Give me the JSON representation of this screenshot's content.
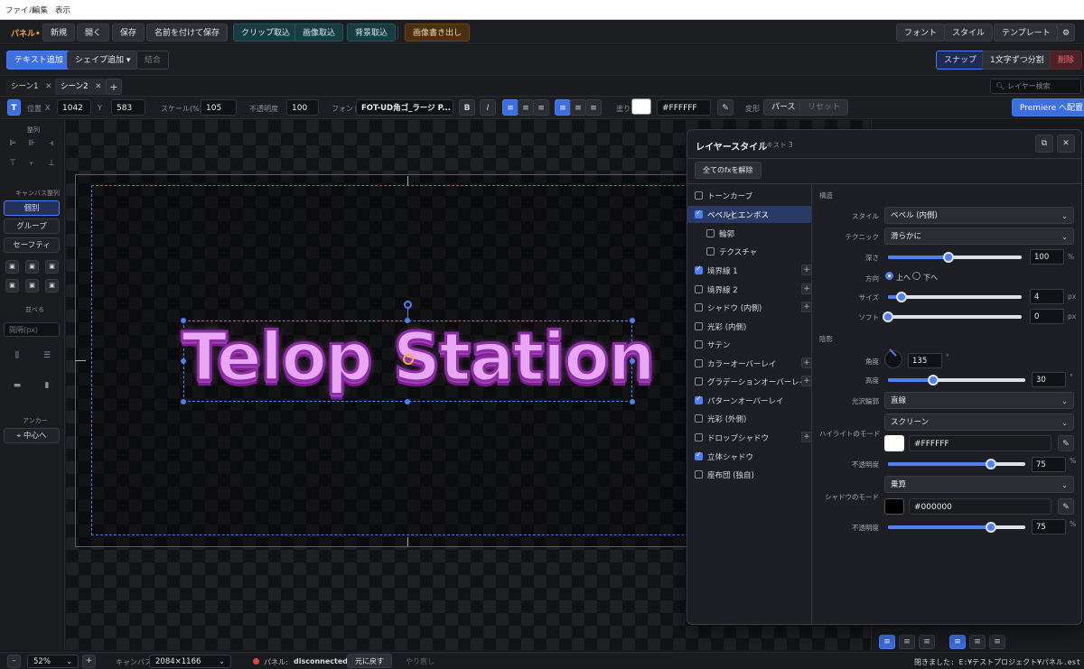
{
  "menubar": {
    "file": "ファイル",
    "edit": "編集",
    "view": "表示"
  },
  "toolbar1": {
    "app_label": "パネル",
    "app_marker": "•",
    "new": "新規",
    "open": "開く",
    "save": "保存",
    "save_as": "名前を付けて保存",
    "clip_import": "クリップ取込",
    "image_import": "画像取込",
    "bg_import": "背景取込",
    "image_export": "画像書き出し",
    "font": "フォント",
    "style": "スタイル",
    "template": "テンプレート",
    "settings_icon": "gear-icon"
  },
  "toolbar2": {
    "add_text": "テキスト追加",
    "add_shape": "シェイプ追加",
    "add_shape_chev": "▾",
    "combine": "結合",
    "snap": "スナップ",
    "split_chars": "1文字ずつ分割",
    "delete": "削除"
  },
  "tabs": {
    "items": [
      {
        "label": "シーン1"
      },
      {
        "label": "シーン2"
      }
    ],
    "add": "+",
    "search_placeholder": "レイヤー検索"
  },
  "props": {
    "type_badge": "T",
    "pos_label": "位置",
    "x_label": "X",
    "x": "1042",
    "y_label": "Y",
    "y": "583",
    "scale_label": "スケール(%)",
    "scale": "105",
    "opacity_label": "不透明度",
    "opacity": "100",
    "font_label": "フォント",
    "font": "FOT-UD角ゴ_ラージ P...",
    "bold": "B",
    "italic": "I",
    "fill_label": "塗り",
    "fill_color": "#FFFFFF",
    "fill_hex": "#FFFFFF",
    "transform_label": "変形",
    "perspective": "パース",
    "reset": "リセット",
    "premiere": "Premiere へ配置"
  },
  "sidebar": {
    "align_title": "整列",
    "canvas_align_title": "キャンバス整列",
    "individual": "個別",
    "group": "グループ",
    "safety": "セーフティ",
    "distribute_title": "並べる",
    "spacing_placeholder": "間隔(px)",
    "anchor_title": "アンカー",
    "center": "中心へ"
  },
  "canvas": {
    "text": "Telop Station"
  },
  "dialog": {
    "title": "レイヤースタイル",
    "subtitle": "— テキスト 3",
    "clear_all": "全てのfxを解除",
    "fx_items": [
      {
        "label": "トーンカーブ",
        "checked": false,
        "plus": false,
        "indent": false
      },
      {
        "label": "ベベルとエンボス",
        "checked": true,
        "plus": false,
        "indent": false,
        "active": true
      },
      {
        "label": "輪郭",
        "checked": false,
        "plus": false,
        "indent": true
      },
      {
        "label": "テクスチャ",
        "checked": false,
        "plus": false,
        "indent": true
      },
      {
        "label": "境界線 1",
        "checked": true,
        "plus": true,
        "indent": false
      },
      {
        "label": "境界線 2",
        "checked": false,
        "plus": true,
        "indent": false
      },
      {
        "label": "シャドウ (内側)",
        "checked": false,
        "plus": true,
        "indent": false
      },
      {
        "label": "光彩 (内側)",
        "checked": false,
        "plus": false,
        "indent": false
      },
      {
        "label": "サテン",
        "checked": false,
        "plus": false,
        "indent": false
      },
      {
        "label": "カラーオーバーレイ",
        "checked": false,
        "plus": true,
        "indent": false
      },
      {
        "label": "グラデーションオーバーレイ",
        "checked": false,
        "plus": true,
        "indent": false
      },
      {
        "label": "パターンオーバーレイ",
        "checked": true,
        "plus": false,
        "indent": false
      },
      {
        "label": "光彩 (外側)",
        "checked": false,
        "plus": false,
        "indent": false
      },
      {
        "label": "ドロップシャドウ",
        "checked": false,
        "plus": true,
        "indent": false
      },
      {
        "label": "立体シャドウ",
        "checked": true,
        "plus": false,
        "indent": false
      },
      {
        "label": "座布団 (独自)",
        "checked": false,
        "plus": false,
        "indent": false
      }
    ],
    "structure_title": "構造",
    "style_label": "スタイル",
    "style_value": "ベベル (内側)",
    "technique_label": "テクニック",
    "technique_value": "滑らかに",
    "depth_label": "深さ",
    "depth_value": "100",
    "depth_unit": "%",
    "depth_level": 0.45,
    "direction_label": "方向",
    "dir_up": "上へ",
    "dir_down": "下へ",
    "size_label": "サイズ",
    "size_value": "4",
    "size_unit": "px",
    "size_level": 0.1,
    "soften_label": "ソフト",
    "soften_value": "0",
    "soften_unit": "px",
    "soften_level": 0.0,
    "shading_title": "陰影",
    "angle_label": "角度",
    "angle_value": "135",
    "angle_unit": "°",
    "altitude_label": "高度",
    "altitude_value": "30",
    "altitude_unit": "°",
    "altitude_level": 0.33,
    "gloss_label": "光沢輪郭",
    "gloss_value": "直線",
    "highlight_mode_label": "ハイライトのモード",
    "highlight_mode": "スクリーン",
    "highlight_hex": "#FFFFFF",
    "highlight_color": "#FFFFFF",
    "hl_opacity_label": "不透明度",
    "hl_opacity": "75",
    "hl_opacity_unit": "%",
    "hl_opacity_level": 0.75,
    "shadow_mode_label": "シャドウのモード",
    "shadow_mode": "乗算",
    "shadow_hex": "#000000",
    "shadow_color": "#000000",
    "sh_opacity_label": "不透明度",
    "sh_opacity": "75",
    "sh_opacity_unit": "%",
    "sh_opacity_level": 0.75
  },
  "statusbar": {
    "zoom": "52%",
    "minus": "-",
    "plus": "+",
    "canvas_label": "キャンバス",
    "canvas_size": "2084×1166",
    "panel_label": "パネル:",
    "panel_status": "disconnected",
    "undo": "元に戻す",
    "redo": "やり直し",
    "saved": "閉きました: E:¥テストプロジェクト¥パネル.est"
  },
  "colors": {
    "accent": "#3d6fe0",
    "status_red": "#e04848"
  }
}
